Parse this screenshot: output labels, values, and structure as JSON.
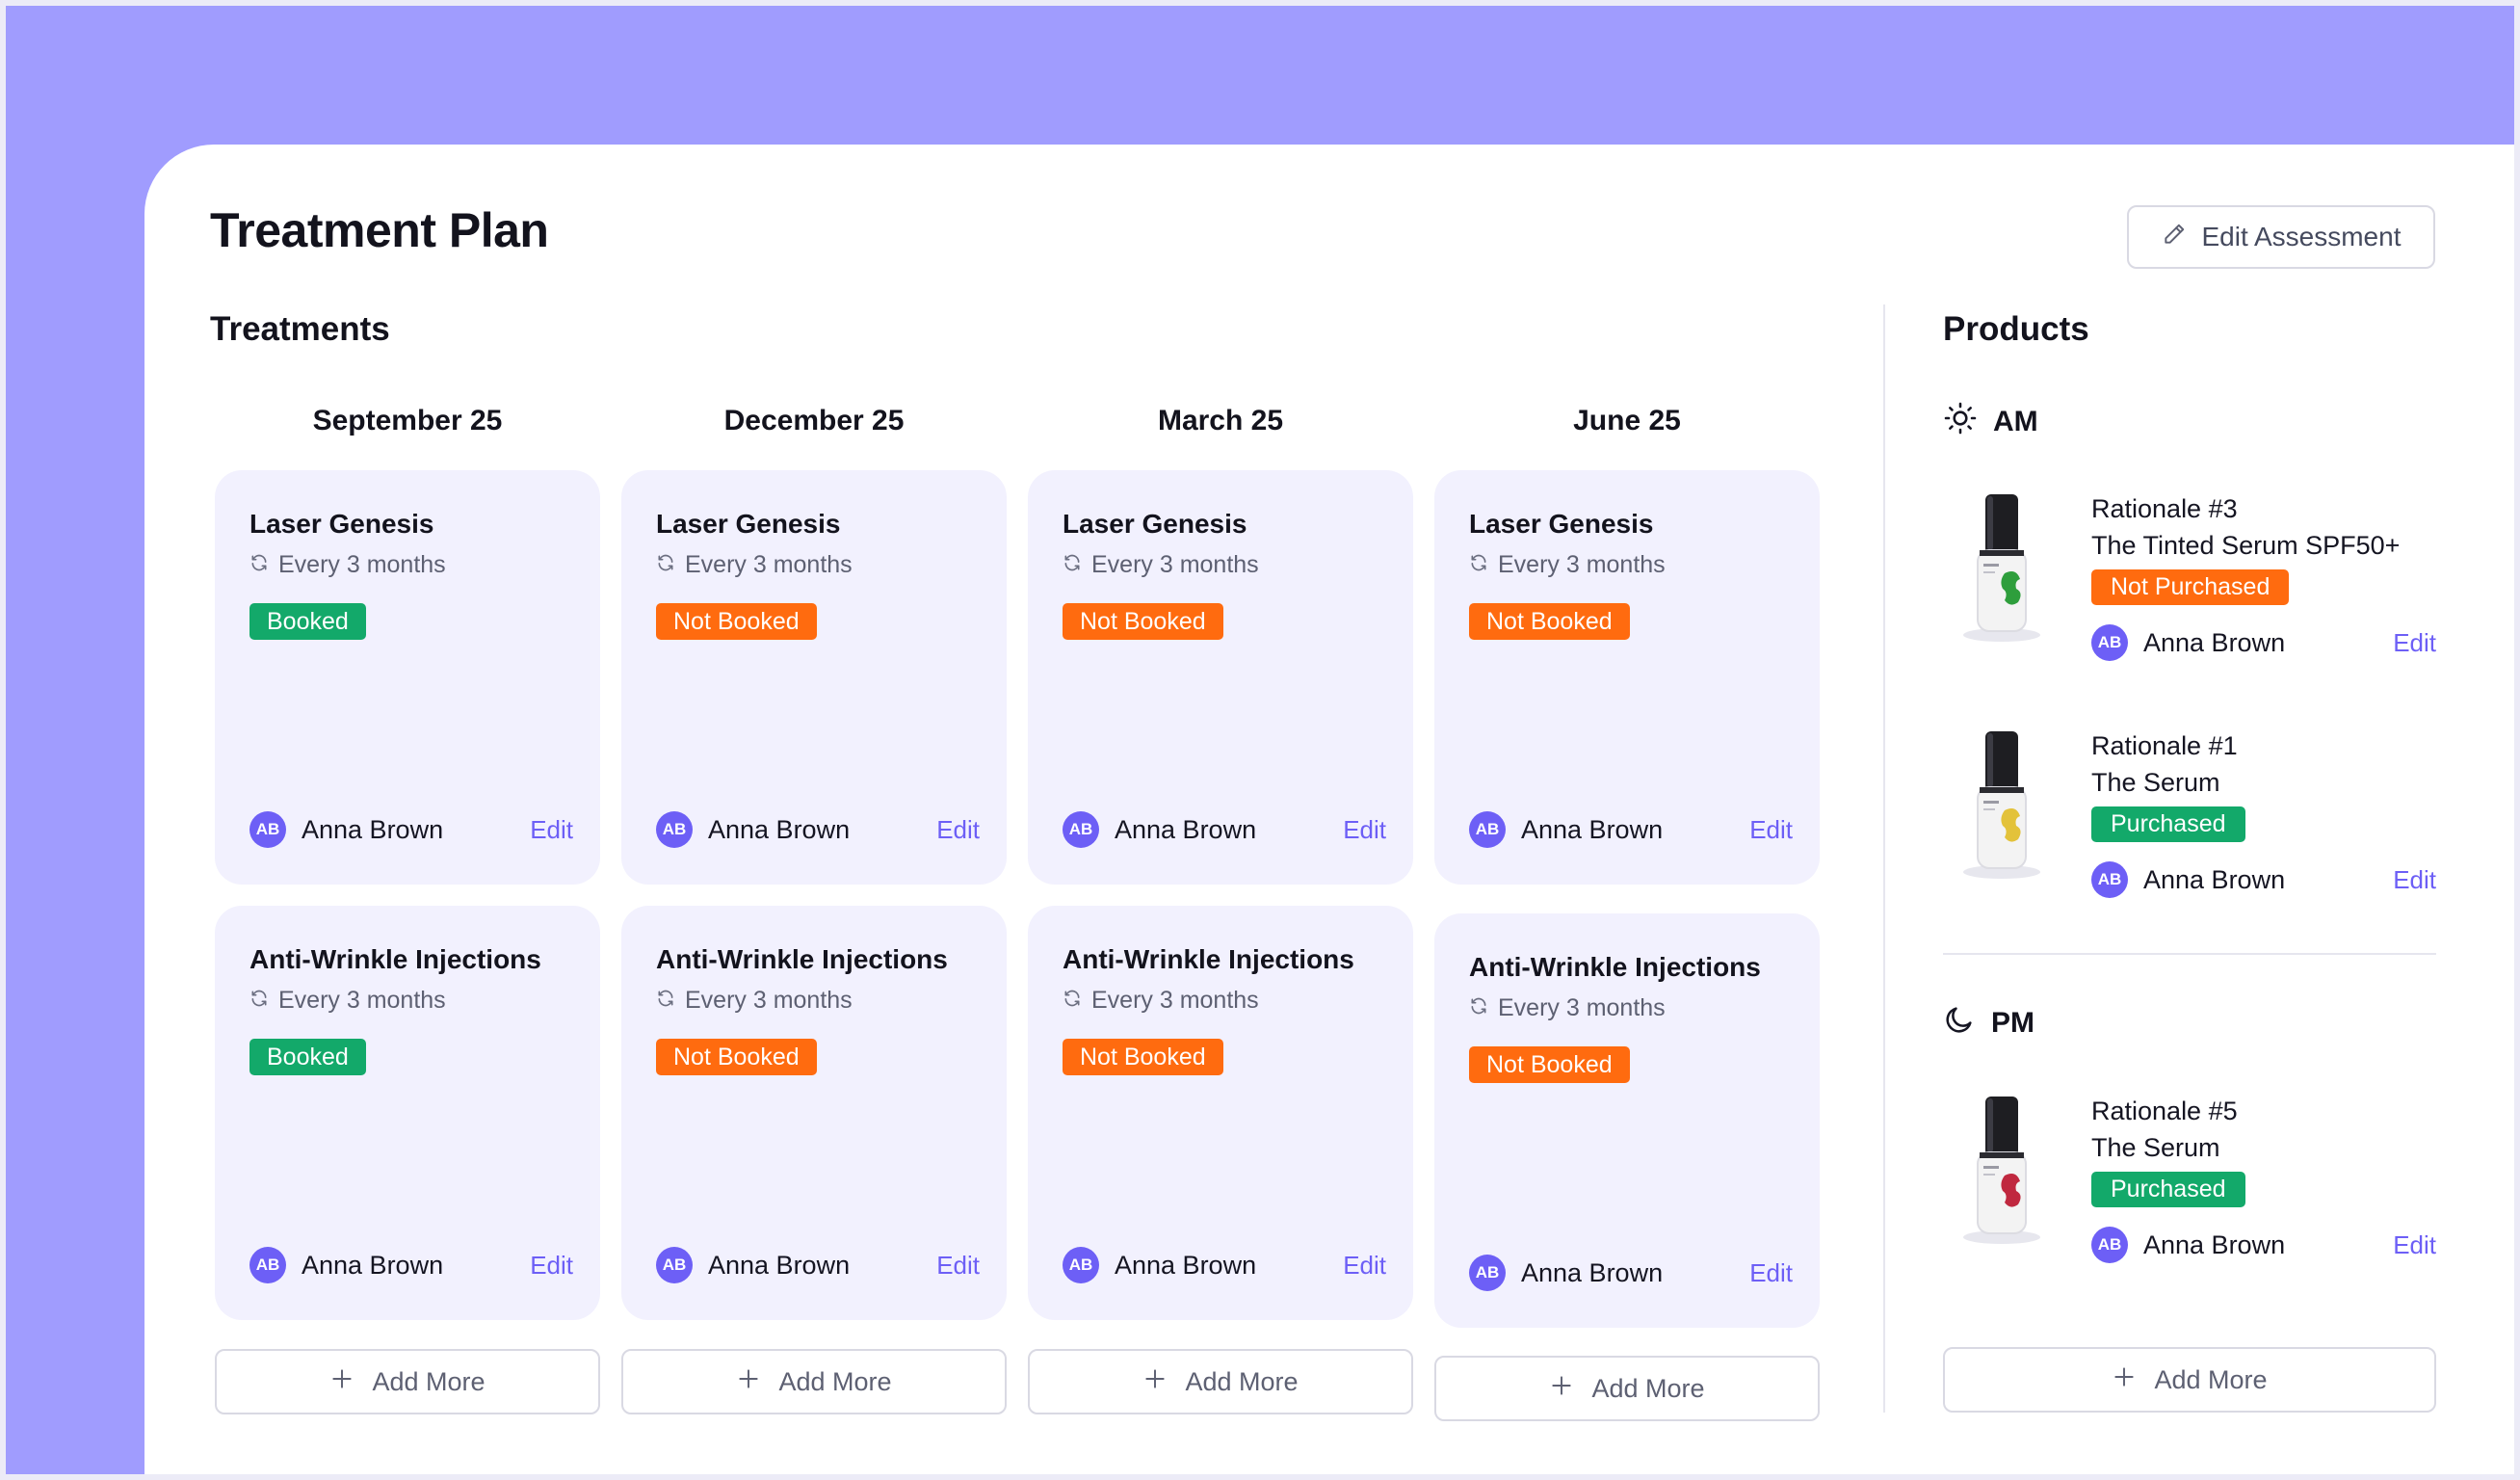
{
  "page": {
    "title": "Treatment Plan",
    "edit_assessment_label": "Edit Assessment"
  },
  "treatments": {
    "heading": "Treatments",
    "add_more_label": "Add More",
    "columns": [
      {
        "date": "September 25",
        "cards": [
          {
            "title": "Laser Genesis",
            "frequency": "Every 3 months",
            "status": "Booked",
            "user_initials": "AB",
            "user_name": "Anna Brown",
            "edit_label": "Edit"
          },
          {
            "title": "Anti-Wrinkle Injections",
            "frequency": "Every 3 months",
            "status": "Booked",
            "user_initials": "AB",
            "user_name": "Anna Brown",
            "edit_label": "Edit"
          }
        ]
      },
      {
        "date": "December 25",
        "cards": [
          {
            "title": "Laser Genesis",
            "frequency": "Every 3 months",
            "status": "Not Booked",
            "user_initials": "AB",
            "user_name": "Anna Brown",
            "edit_label": "Edit"
          },
          {
            "title": "Anti-Wrinkle Injections",
            "frequency": "Every 3 months",
            "status": "Not Booked",
            "user_initials": "AB",
            "user_name": "Anna Brown",
            "edit_label": "Edit"
          }
        ]
      },
      {
        "date": "March 25",
        "cards": [
          {
            "title": "Laser Genesis",
            "frequency": "Every 3 months",
            "status": "Not Booked",
            "user_initials": "AB",
            "user_name": "Anna Brown",
            "edit_label": "Edit"
          },
          {
            "title": "Anti-Wrinkle Injections",
            "frequency": "Every 3 months",
            "status": "Not Booked",
            "user_initials": "AB",
            "user_name": "Anna Brown",
            "edit_label": "Edit"
          }
        ]
      },
      {
        "date": "June 25",
        "cards": [
          {
            "title": "Laser Genesis",
            "frequency": "Every 3 months",
            "status": "Not Booked",
            "user_initials": "AB",
            "user_name": "Anna Brown",
            "edit_label": "Edit"
          },
          {
            "title": "Anti-Wrinkle Injections",
            "frequency": "Every 3 months",
            "status": "Not Booked",
            "user_initials": "AB",
            "user_name": "Anna Brown",
            "edit_label": "Edit"
          }
        ]
      }
    ]
  },
  "products": {
    "heading": "Products",
    "add_more_label": "Add More",
    "am": {
      "label": "AM",
      "icon": "sun-icon",
      "items": [
        {
          "name": "Rationale #3",
          "subtitle": "The Tinted Serum SPF50+",
          "status": "Not Purchased",
          "bottle_accent": "#2e9e3c",
          "user_initials": "AB",
          "user_name": "Anna Brown",
          "edit_label": "Edit"
        },
        {
          "name": "Rationale #1",
          "subtitle": "The Serum",
          "status": "Purchased",
          "bottle_accent": "#e3c23a",
          "user_initials": "AB",
          "user_name": "Anna Brown",
          "edit_label": "Edit"
        }
      ]
    },
    "pm": {
      "label": "PM",
      "icon": "moon-icon",
      "items": [
        {
          "name": "Rationale #5",
          "subtitle": "The Serum",
          "status": "Purchased",
          "bottle_accent": "#c0283f",
          "user_initials": "AB",
          "user_name": "Anna Brown",
          "edit_label": "Edit"
        }
      ]
    }
  },
  "colors": {
    "accent": "#6d5ff6",
    "header_band": "#a09cfe",
    "booked": "#13a96a",
    "not_booked": "#ff6b0f",
    "card_bg": "#f2f1fe"
  }
}
